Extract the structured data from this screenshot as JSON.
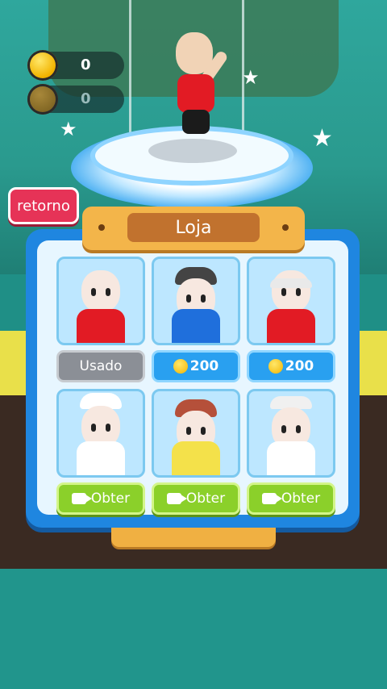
{
  "currency": {
    "primary": "0",
    "secondary": "0"
  },
  "back_button": {
    "label": "retorno"
  },
  "shop": {
    "title": "Loja",
    "items": [
      {
        "action": "Usado",
        "shirt": "#e21b24"
      },
      {
        "action": "200",
        "shirt": "#1f6fdc"
      },
      {
        "action": "200",
        "shirt": "#e21b24"
      },
      {
        "action": "Obter",
        "shirt": "#ffffff"
      },
      {
        "action": "Obter",
        "shirt": "#f4e14a"
      },
      {
        "action": "Obter",
        "shirt": "#ffffff"
      }
    ]
  },
  "colors": {
    "panel": "#1f86e0",
    "back_button": "#e63357",
    "price_button": "#29a0f0",
    "get_button": "#8bd02a",
    "used_button": "#8b8f96"
  },
  "icons": [
    "coin-icon",
    "star-icon",
    "video-icon"
  ]
}
